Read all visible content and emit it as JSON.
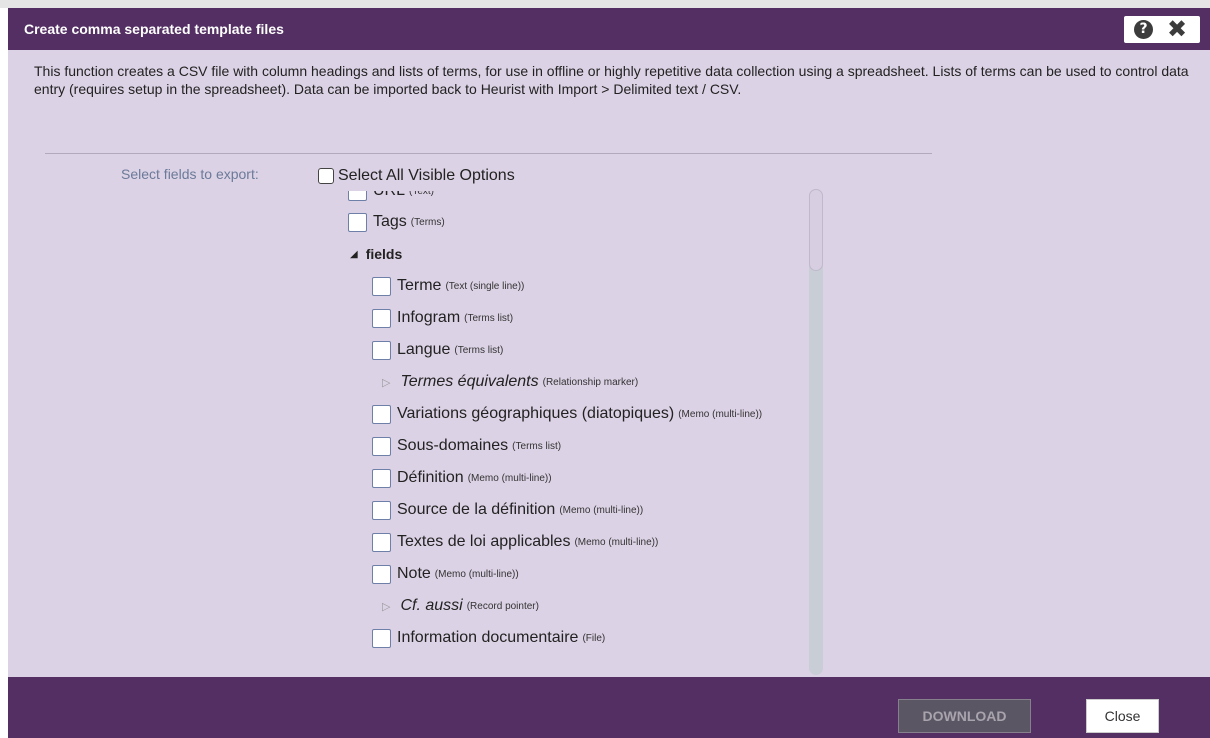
{
  "dialog": {
    "title": "Create comma separated template files",
    "help_glyph": "?",
    "close_glyph": "✖"
  },
  "description": "This function creates a CSV file with column headings and lists of terms, for use in offline or highly repetitive data collection using a spreadsheet. Lists of terms can be used to control data entry (requires setup in the spreadsheet). Data can be imported back to Heurist with Import > Delimited text / CSV.",
  "form": {
    "select_label": "Select fields to export:",
    "select_all_label": "Select All Visible Options"
  },
  "tree": {
    "partial_item": {
      "label": "URL",
      "type": "(Text)"
    },
    "tags_item": {
      "label": "Tags",
      "type": "(Terms)"
    },
    "group": {
      "label": "fields",
      "expanded": true
    },
    "fields": [
      {
        "label": "Terme",
        "type": "(Text (single line))",
        "kind": "checkbox"
      },
      {
        "label": "Infogram",
        "type": "(Terms list)",
        "kind": "checkbox"
      },
      {
        "label": "Langue",
        "type": "(Terms list)",
        "kind": "checkbox"
      },
      {
        "label": "Termes équivalents",
        "type": "(Relationship marker)",
        "kind": "collapsed"
      },
      {
        "label": "Variations géographiques (diatopiques)",
        "type": "(Memo (multi-line))",
        "kind": "checkbox"
      },
      {
        "label": "Sous-domaines",
        "type": "(Terms list)",
        "kind": "checkbox"
      },
      {
        "label": "Définition",
        "type": "(Memo (multi-line))",
        "kind": "checkbox"
      },
      {
        "label": "Source de la définition",
        "type": "(Memo (multi-line))",
        "kind": "checkbox"
      },
      {
        "label": "Textes de loi applicables",
        "type": "(Memo (multi-line))",
        "kind": "checkbox"
      },
      {
        "label": "Note",
        "type": "(Memo (multi-line))",
        "kind": "checkbox"
      },
      {
        "label": "Cf. aussi",
        "type": "(Record pointer)",
        "kind": "collapsed"
      },
      {
        "label": "Information documentaire",
        "type": "(File)",
        "kind": "checkbox"
      }
    ]
  },
  "buttons": {
    "download": "DOWNLOAD",
    "close": "Close"
  },
  "colors": {
    "header_bg": "#532f63",
    "body_bg": "#dcd2e5",
    "checkbox_border": "#6e7fa8"
  }
}
